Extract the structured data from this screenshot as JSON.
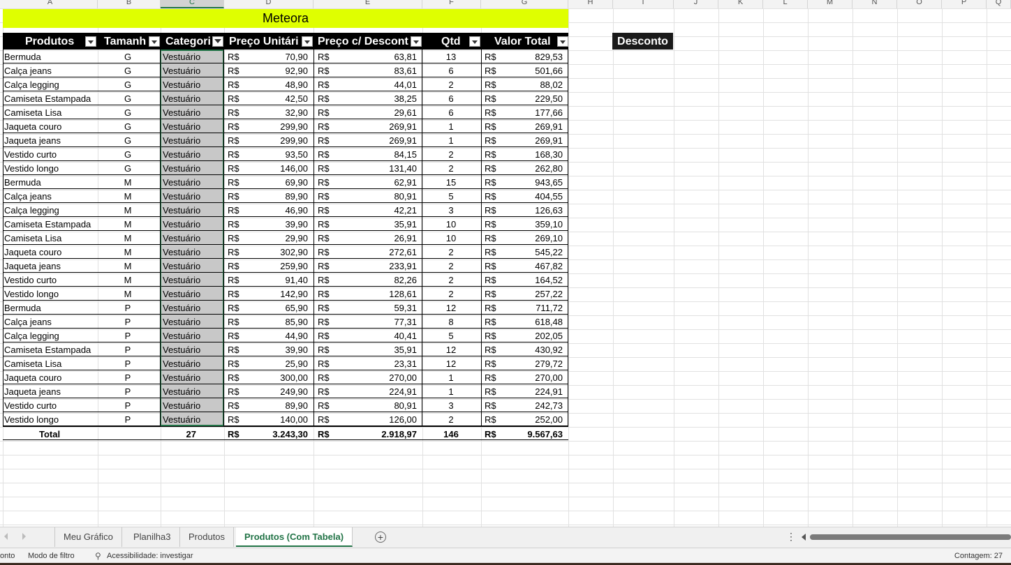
{
  "column_headers": [
    "A",
    "B",
    "C",
    "D",
    "E",
    "F",
    "G",
    "H",
    "I",
    "J",
    "K",
    "L",
    "M",
    "N",
    "O",
    "P",
    "Q"
  ],
  "selected_column": "C",
  "table_title": "Meteora",
  "headers": [
    "Produtos",
    "Tamanh",
    "Categori",
    "Preço Unitári",
    "Preço c/ Descont",
    "Qtd",
    "Valor Total"
  ],
  "currency": "R$",
  "desconto_label": "Desconto",
  "rows": [
    {
      "produto": "Bermuda",
      "tamanho": "G",
      "categoria": "Vestuário",
      "preco": "70,90",
      "desconto": "63,81",
      "qtd": "13",
      "total": "829,53"
    },
    {
      "produto": "Calça jeans",
      "tamanho": "G",
      "categoria": "Vestuário",
      "preco": "92,90",
      "desconto": "83,61",
      "qtd": "6",
      "total": "501,66"
    },
    {
      "produto": "Calça legging",
      "tamanho": "G",
      "categoria": "Vestuário",
      "preco": "48,90",
      "desconto": "44,01",
      "qtd": "2",
      "total": "88,02"
    },
    {
      "produto": "Camiseta Estampada",
      "tamanho": "G",
      "categoria": "Vestuário",
      "preco": "42,50",
      "desconto": "38,25",
      "qtd": "6",
      "total": "229,50"
    },
    {
      "produto": "Camiseta Lisa",
      "tamanho": "G",
      "categoria": "Vestuário",
      "preco": "32,90",
      "desconto": "29,61",
      "qtd": "6",
      "total": "177,66"
    },
    {
      "produto": "Jaqueta couro",
      "tamanho": "G",
      "categoria": "Vestuário",
      "preco": "299,90",
      "desconto": "269,91",
      "qtd": "1",
      "total": "269,91"
    },
    {
      "produto": "Jaqueta jeans",
      "tamanho": "G",
      "categoria": "Vestuário",
      "preco": "299,90",
      "desconto": "269,91",
      "qtd": "1",
      "total": "269,91"
    },
    {
      "produto": "Vestido curto",
      "tamanho": "G",
      "categoria": "Vestuário",
      "preco": "93,50",
      "desconto": "84,15",
      "qtd": "2",
      "total": "168,30"
    },
    {
      "produto": "Vestido longo",
      "tamanho": "G",
      "categoria": "Vestuário",
      "preco": "146,00",
      "desconto": "131,40",
      "qtd": "2",
      "total": "262,80"
    },
    {
      "produto": "Bermuda",
      "tamanho": "M",
      "categoria": "Vestuário",
      "preco": "69,90",
      "desconto": "62,91",
      "qtd": "15",
      "total": "943,65"
    },
    {
      "produto": "Calça jeans",
      "tamanho": "M",
      "categoria": "Vestuário",
      "preco": "89,90",
      "desconto": "80,91",
      "qtd": "5",
      "total": "404,55"
    },
    {
      "produto": "Calça legging",
      "tamanho": "M",
      "categoria": "Vestuário",
      "preco": "46,90",
      "desconto": "42,21",
      "qtd": "3",
      "total": "126,63"
    },
    {
      "produto": "Camiseta Estampada",
      "tamanho": "M",
      "categoria": "Vestuário",
      "preco": "39,90",
      "desconto": "35,91",
      "qtd": "10",
      "total": "359,10"
    },
    {
      "produto": "Camiseta Lisa",
      "tamanho": "M",
      "categoria": "Vestuário",
      "preco": "29,90",
      "desconto": "26,91",
      "qtd": "10",
      "total": "269,10"
    },
    {
      "produto": "Jaqueta couro",
      "tamanho": "M",
      "categoria": "Vestuário",
      "preco": "302,90",
      "desconto": "272,61",
      "qtd": "2",
      "total": "545,22"
    },
    {
      "produto": "Jaqueta jeans",
      "tamanho": "M",
      "categoria": "Vestuário",
      "preco": "259,90",
      "desconto": "233,91",
      "qtd": "2",
      "total": "467,82"
    },
    {
      "produto": "Vestido curto",
      "tamanho": "M",
      "categoria": "Vestuário",
      "preco": "91,40",
      "desconto": "82,26",
      "qtd": "2",
      "total": "164,52"
    },
    {
      "produto": "Vestido longo",
      "tamanho": "M",
      "categoria": "Vestuário",
      "preco": "142,90",
      "desconto": "128,61",
      "qtd": "2",
      "total": "257,22"
    },
    {
      "produto": "Bermuda",
      "tamanho": "P",
      "categoria": "Vestuário",
      "preco": "65,90",
      "desconto": "59,31",
      "qtd": "12",
      "total": "711,72"
    },
    {
      "produto": "Calça jeans",
      "tamanho": "P",
      "categoria": "Vestuário",
      "preco": "85,90",
      "desconto": "77,31",
      "qtd": "8",
      "total": "618,48"
    },
    {
      "produto": "Calça legging",
      "tamanho": "P",
      "categoria": "Vestuário",
      "preco": "44,90",
      "desconto": "40,41",
      "qtd": "5",
      "total": "202,05"
    },
    {
      "produto": "Camiseta Estampada",
      "tamanho": "P",
      "categoria": "Vestuário",
      "preco": "39,90",
      "desconto": "35,91",
      "qtd": "12",
      "total": "430,92"
    },
    {
      "produto": "Camiseta Lisa",
      "tamanho": "P",
      "categoria": "Vestuário",
      "preco": "25,90",
      "desconto": "23,31",
      "qtd": "12",
      "total": "279,72"
    },
    {
      "produto": "Jaqueta couro",
      "tamanho": "P",
      "categoria": "Vestuário",
      "preco": "300,00",
      "desconto": "270,00",
      "qtd": "1",
      "total": "270,00"
    },
    {
      "produto": "Jaqueta jeans",
      "tamanho": "P",
      "categoria": "Vestuário",
      "preco": "249,90",
      "desconto": "224,91",
      "qtd": "1",
      "total": "224,91"
    },
    {
      "produto": "Vestido curto",
      "tamanho": "P",
      "categoria": "Vestuário",
      "preco": "89,90",
      "desconto": "80,91",
      "qtd": "3",
      "total": "242,73"
    },
    {
      "produto": "Vestido longo",
      "tamanho": "P",
      "categoria": "Vestuário",
      "preco": "140,00",
      "desconto": "126,00",
      "qtd": "2",
      "total": "252,00"
    }
  ],
  "totals": {
    "label": "Total",
    "count": "27",
    "preco": "3.243,30",
    "desconto": "2.918,97",
    "qtd": "146",
    "total": "9.567,63"
  },
  "sheet_tabs": [
    "Meu Gráfico",
    "Planilha3",
    "Produtos",
    "Produtos (Com Tabela)"
  ],
  "active_tab": "Produtos (Com Tabela)",
  "status": {
    "left_fragment": "onto",
    "filter_mode": "Modo de filtro",
    "accessibility": "Acessibilidade: investigar",
    "count": "Contagem: 27"
  },
  "colors": {
    "title_bg": "#dfff00",
    "header_bg": "#000000",
    "accent": "#217346",
    "category_fill": "#c8c8c8"
  }
}
